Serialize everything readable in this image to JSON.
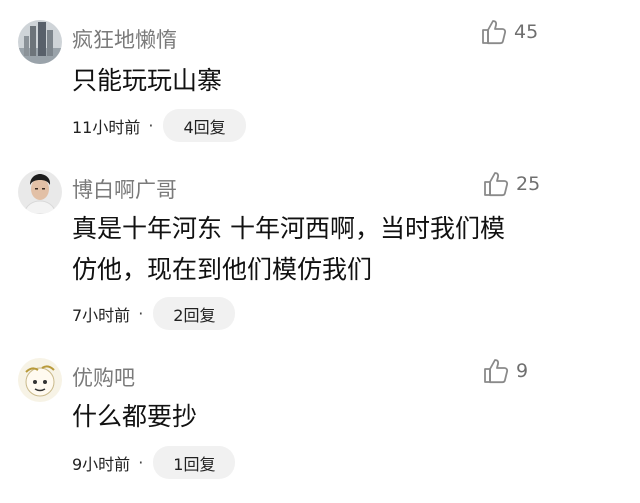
{
  "comments": [
    {
      "username": "疯狂地懒惰",
      "likes": "45",
      "content_lines": [
        "只能玩玩山寨"
      ],
      "time": "11小时前",
      "dot": "·",
      "replies": "4回复"
    },
    {
      "username": "博白啊广哥",
      "likes": "25",
      "content_lines": [
        "真是十年河东 十年河西啊，当时我们模",
        "仿他，现在到他们模仿我们"
      ],
      "time": "7小时前",
      "dot": "·",
      "replies": "2回复"
    },
    {
      "username": "优购吧",
      "likes": "9",
      "content_lines": [
        "什么都要抄"
      ],
      "time": "9小时前",
      "dot": "·",
      "replies": "1回复"
    }
  ],
  "colors": {
    "username": "#7a7a7a",
    "content": "#111111",
    "pill": "#f1f1f1"
  }
}
